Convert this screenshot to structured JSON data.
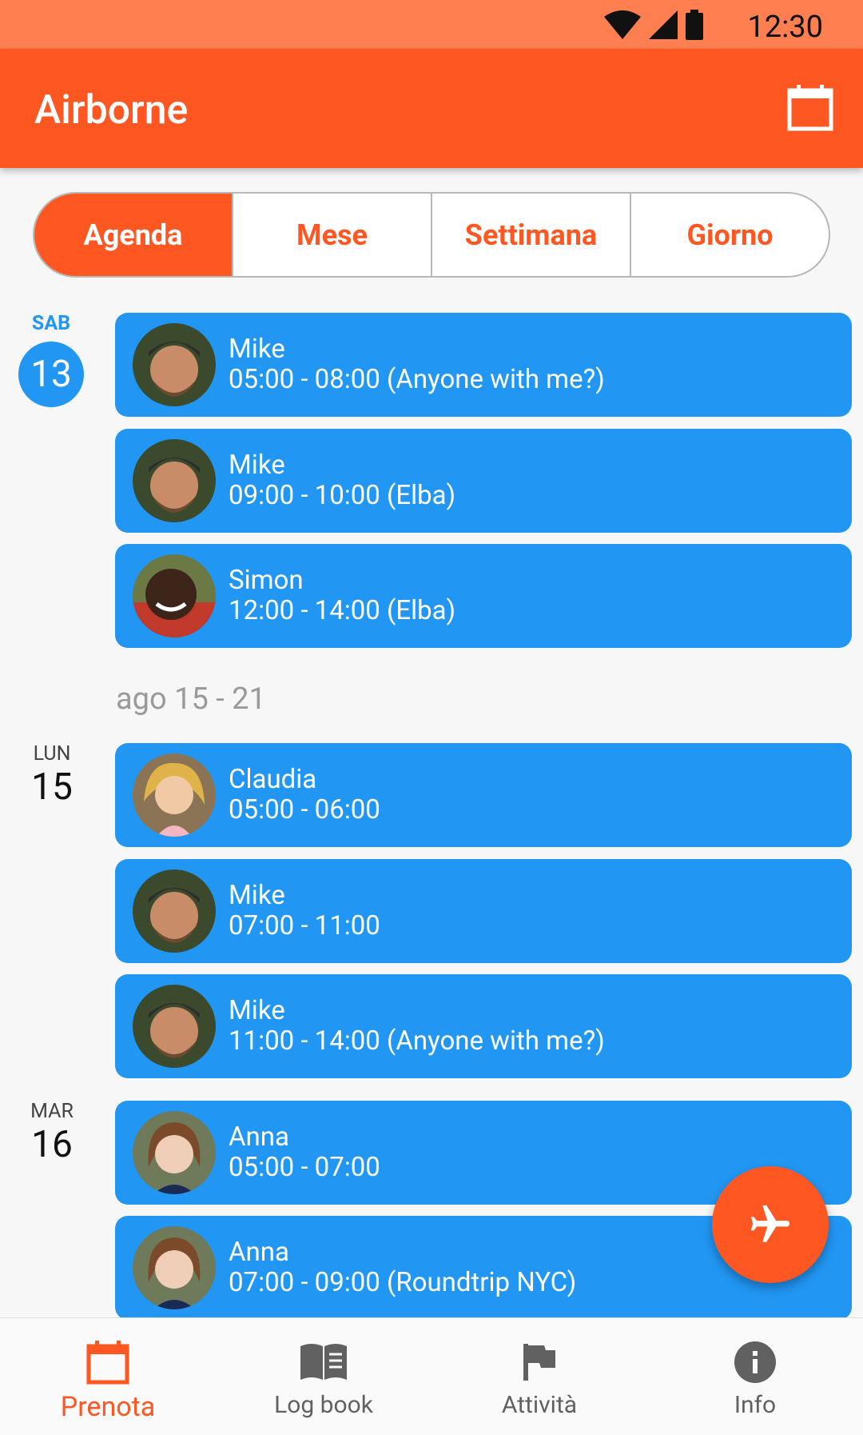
{
  "status_bar": {
    "time": "12:30",
    "icons": [
      "wifi-icon",
      "cell-signal-icon",
      "battery-icon"
    ]
  },
  "app_bar": {
    "title": "Airborne",
    "action_icon": "calendar-icon"
  },
  "view_tabs": [
    {
      "label": "Agenda",
      "active": true
    },
    {
      "label": "Mese",
      "active": false
    },
    {
      "label": "Settimana",
      "active": false
    },
    {
      "label": "Giorno",
      "active": false
    }
  ],
  "days": [
    {
      "dow": "SAB",
      "num": "13",
      "today": true
    },
    {
      "dow": "LUN",
      "num": "15",
      "today": false
    },
    {
      "dow": "MAR",
      "num": "16",
      "today": false
    }
  ],
  "week_range": "ago 15 - 21",
  "events": [
    {
      "name": "Mike",
      "time": "05:00 - 08:00 (Anyone with me?)"
    },
    {
      "name": "Mike",
      "time": "09:00 - 10:00 (Elba)"
    },
    {
      "name": "Simon",
      "time": "12:00 - 14:00 (Elba)"
    },
    {
      "name": "Claudia",
      "time": "05:00 - 06:00"
    },
    {
      "name": "Mike",
      "time": "07:00 - 11:00"
    },
    {
      "name": "Mike",
      "time": "11:00 - 14:00 (Anyone with me?)"
    },
    {
      "name": "Anna",
      "time": "05:00 - 07:00"
    },
    {
      "name": "Anna",
      "time": "07:00 - 09:00 (Roundtrip NYC)"
    }
  ],
  "fab_icon": "airplane-icon",
  "bottom_nav": [
    {
      "label": "Prenota",
      "icon": "calendar-icon",
      "active": true
    },
    {
      "label": "Log book",
      "icon": "book-icon",
      "active": false
    },
    {
      "label": "Attività",
      "icon": "flag-icon",
      "active": false
    },
    {
      "label": "Info",
      "icon": "info-icon",
      "active": false
    }
  ],
  "colors": {
    "primary": "#ff5722",
    "status_bar": "#ff7f50",
    "event": "#2196f3",
    "today": "#2196f3"
  }
}
